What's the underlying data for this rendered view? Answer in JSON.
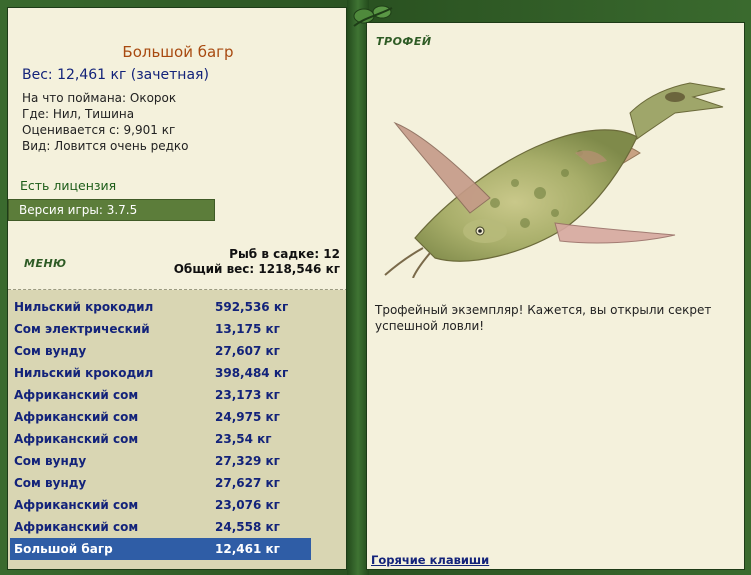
{
  "fish": {
    "title": "Большой багр",
    "weight_line": "Вес: 12,461 кг (зачетная)",
    "bait": "На что поймана: Окорок",
    "place": "Где: Нил, Тишина",
    "valued": "Оценивается с: 9,901 кг",
    "kind": "Вид: Ловится очень редко"
  },
  "license": "Есть лицензия",
  "version": "Версия игры: 3.7.5",
  "menu_label": "МЕНЮ",
  "keep": {
    "count_line": "Рыб в садке: 12",
    "total_line": "Общий вес: 1218,546 кг"
  },
  "catch_list": [
    {
      "name": "Нильский крокодил",
      "weight": "592,536 кг"
    },
    {
      "name": "Сом электрический",
      "weight": "13,175 кг"
    },
    {
      "name": "Сом вунду",
      "weight": "27,607 кг"
    },
    {
      "name": "Нильский крокодил",
      "weight": "398,484 кг"
    },
    {
      "name": "Африканский сом",
      "weight": "23,173 кг"
    },
    {
      "name": "Африканский сом",
      "weight": "24,975 кг"
    },
    {
      "name": "Африканский сом",
      "weight": "23,54 кг"
    },
    {
      "name": "Сом вунду",
      "weight": "27,329 кг"
    },
    {
      "name": "Сом вунду",
      "weight": "27,627 кг"
    },
    {
      "name": "Африканский сом",
      "weight": "23,076 кг"
    },
    {
      "name": "Африканский сом",
      "weight": "24,558 кг"
    },
    {
      "name": "Большой багр",
      "weight": "12,461 кг",
      "selected": true
    }
  ],
  "trophy": {
    "label": "ТРОФЕЙ",
    "text": "Трофейный экземпляр! Кажется, вы открыли секрет успешной ловли!"
  },
  "hotkeys_label": "Горячие клавиши",
  "colors": {
    "frame": "#2f5a26",
    "panel": "#f4f1dc",
    "list_bg": "#d9d6b3",
    "selected_row": "#2f5da6",
    "link": "#13237a",
    "title": "#a84a10"
  }
}
